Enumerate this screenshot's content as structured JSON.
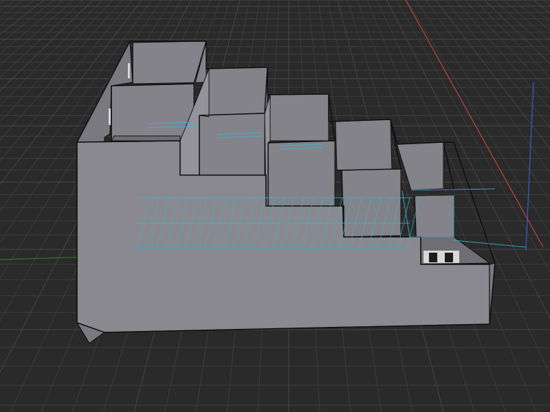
{
  "viewport": {
    "background": "#2a2a2a",
    "grid_color": "#3d3d3d",
    "grid_major_color": "#474747",
    "axis_x_color": "#c4463b",
    "axis_y_color": "#2c7a2c",
    "axis_z_color": "#3a5fcf",
    "selection_color": "#3ab6d4"
  },
  "model": {
    "face_color": "#8a898f",
    "face_light_color": "#94939a",
    "face_dark_color": "#7a7980",
    "interior_wall_color": "#84838a",
    "interior_floor_color": "#6f6e74",
    "edge_color": "#111111",
    "fixture_light_color": "#d8d8d8"
  }
}
